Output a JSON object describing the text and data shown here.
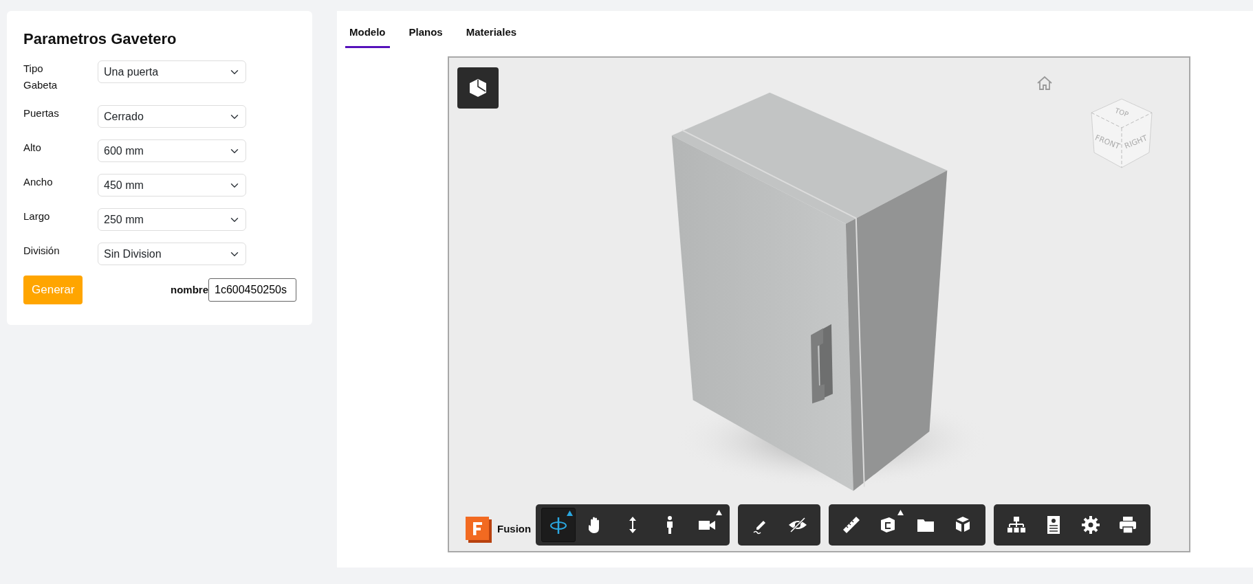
{
  "form": {
    "title": "Parametros Gavetero",
    "fields": [
      {
        "label": "Tipo Gabeta",
        "value": "Una puerta"
      },
      {
        "label": "Puertas",
        "value": "Cerrado"
      },
      {
        "label": "Alto",
        "value": "600 mm"
      },
      {
        "label": "Ancho",
        "value": "450 mm"
      },
      {
        "label": "Largo",
        "value": "250 mm"
      },
      {
        "label": "División",
        "value": "Sin Division"
      }
    ],
    "submit": "Generar",
    "name_field": {
      "label": "nombre",
      "value": "1c600450250s"
    }
  },
  "tabs": [
    {
      "label": "Modelo",
      "selected": true
    },
    {
      "label": "Planos",
      "selected": false
    },
    {
      "label": "Materiales",
      "selected": false
    }
  ],
  "viewer": {
    "viewcube": {
      "top": "TOP",
      "front": "FRONT",
      "right": "RIGHT"
    },
    "brand": "Fusion",
    "toolbar": [
      {
        "tools": [
          {
            "kind": "orbit",
            "selected": true,
            "submenu": true
          },
          {
            "kind": "pan",
            "selected": false,
            "submenu": false
          },
          {
            "kind": "zoom",
            "selected": false,
            "submenu": false
          },
          {
            "kind": "walk",
            "selected": false,
            "submenu": false
          },
          {
            "kind": "camera",
            "selected": false,
            "submenu": true
          }
        ]
      },
      {
        "tools": [
          {
            "kind": "markup",
            "selected": false,
            "submenu": false
          },
          {
            "kind": "hide",
            "selected": false,
            "submenu": false
          }
        ]
      },
      {
        "tools": [
          {
            "kind": "measure",
            "selected": false,
            "submenu": false
          },
          {
            "kind": "section",
            "selected": false,
            "submenu": true
          },
          {
            "kind": "folder",
            "selected": false,
            "submenu": false
          },
          {
            "kind": "explode",
            "selected": false,
            "submenu": false
          }
        ]
      },
      {
        "tools": [
          {
            "kind": "tree",
            "selected": false,
            "submenu": false
          },
          {
            "kind": "properties",
            "selected": false,
            "submenu": false
          },
          {
            "kind": "settings",
            "selected": false,
            "submenu": false
          },
          {
            "kind": "print",
            "selected": false,
            "submenu": false
          }
        ]
      }
    ]
  }
}
